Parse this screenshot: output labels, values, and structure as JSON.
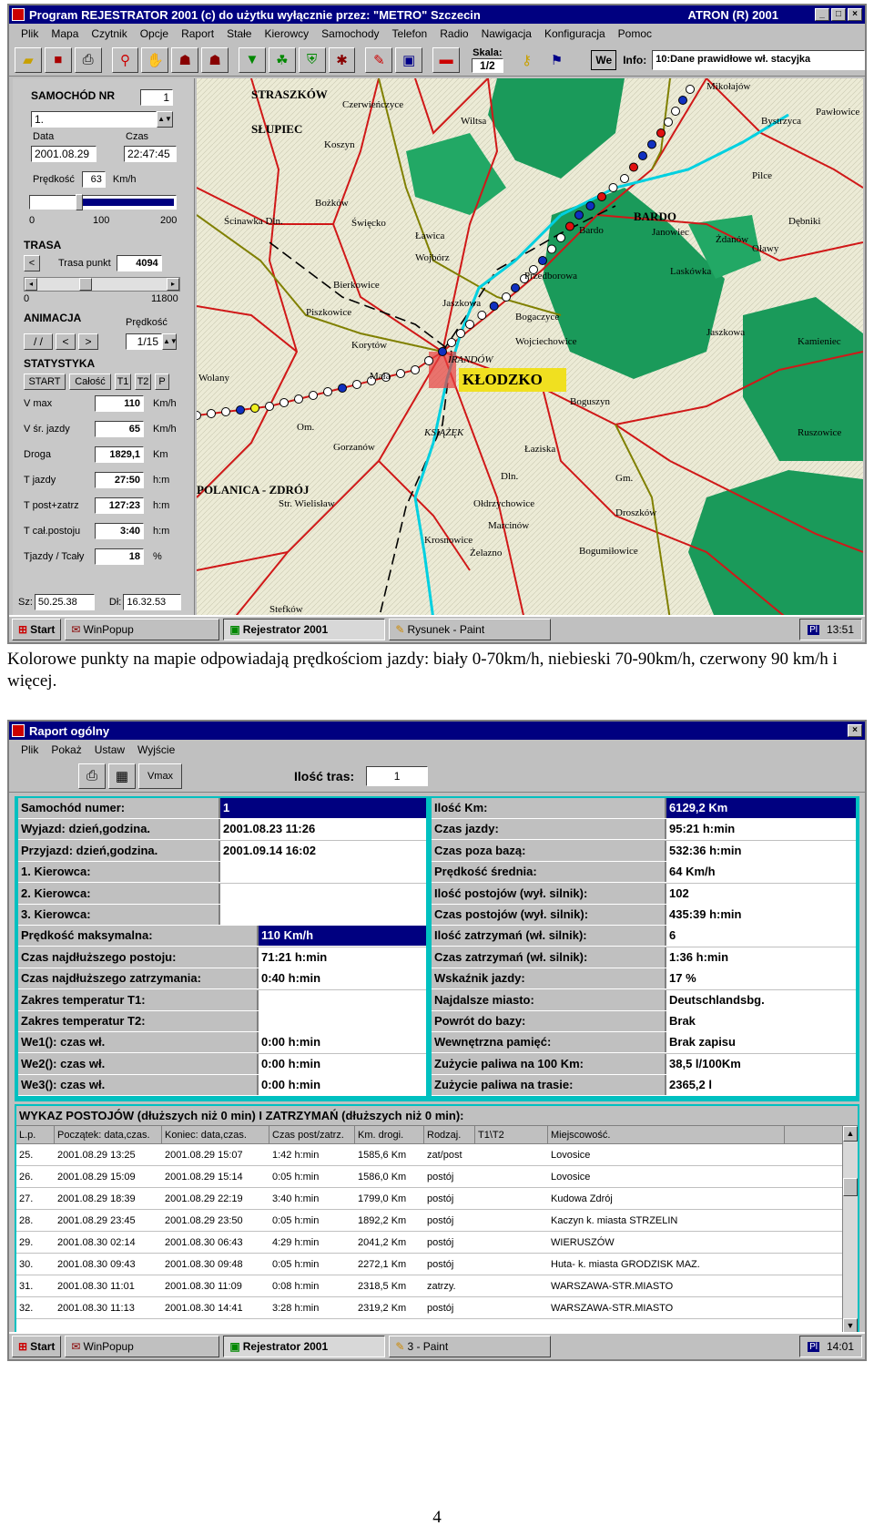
{
  "window1": {
    "title": "Program REJESTRATOR 2001 (c) do użytku wyłącznie przez: \"METRO\" Szczecin",
    "title_right": "ATRON (R) 2001",
    "title_buttons": [
      "_",
      "□",
      "×"
    ],
    "menu": [
      "Plik",
      "Mapa",
      "Czytnik",
      "Opcje",
      "Raport",
      "Stałe",
      "Kierowcy",
      "Samochody",
      "Telefon",
      "Radio",
      "Nawigacja",
      "Konfiguracja",
      "Pomoc"
    ],
    "toolbar": {
      "skala_label": "Skala:",
      "skala_value": "1/2",
      "we_label": "We",
      "info_label": "Info:",
      "info_value": "10:Dane prawidłowe wł. stacyjka"
    },
    "side": {
      "samochod_label": "SAMOCHÓD NR",
      "samochod_nr": "1",
      "samochod_name": "1.",
      "data_label": "Data",
      "czas_label": "Czas",
      "data_value": "2001.08.29",
      "czas_value": "22:47:45",
      "predkosc_label": "Prędkość",
      "predkosc_value": "63",
      "predkosc_unit": "Km/h",
      "speed_level": 0.32,
      "scale_0": "0",
      "scale_100": "100",
      "scale_200": "200",
      "trasa_label": "TRASA",
      "trasa_punkt_label": "Trasa punkt",
      "trasa_punkt_value": "4094",
      "trasa_min": "0",
      "trasa_max": "11800",
      "trasa_level": 0.35,
      "animacja_label": "ANIMACJA",
      "anim_predkosc_label": "Prędkość",
      "anim_predkosc_value": "1/15",
      "anim_buttons": [
        "/ /",
        "<",
        ">"
      ],
      "statystyka_label": "STATYSTYKA",
      "stat_buttons": [
        "START",
        "Całość",
        "T1",
        "T2",
        "P"
      ],
      "stats": [
        {
          "k": "V max",
          "v": "110",
          "u": "Km/h"
        },
        {
          "k": "V śr. jazdy",
          "v": "65",
          "u": "Km/h"
        },
        {
          "k": "Droga",
          "v": "1829,1",
          "u": "Km"
        },
        {
          "k": "T jazdy",
          "v": "27:50",
          "u": "h:m"
        },
        {
          "k": "T post+zatrz",
          "v": "127:23",
          "u": "h:m"
        },
        {
          "k": "T cał.postoju",
          "v": "3:40",
          "u": "h:m"
        },
        {
          "k": "Tjazdy / Tcały",
          "v": "18",
          "u": "%"
        }
      ],
      "sz_label": "Sz:",
      "sz_value": "50.25.38",
      "dl_label": "Dł:",
      "dl_value": "16.32.53"
    },
    "map_labels": [
      "STRASZKÓW",
      "Czerwieńczyce",
      "SŁUPIEC",
      "Koszyn",
      "Wiltsa",
      "Mikołajów",
      "Bystrzyca",
      "Pawłowice",
      "Ścinawka Dln.",
      "Bożków",
      "Święcko",
      "Ławica",
      "Bardo",
      "BARDO",
      "Janowiec",
      "Pilce",
      "Dębniki",
      "Żdanów",
      "Oławy",
      "Przedborowa",
      "Piszkowice",
      "Wojbórz",
      "Laskówka",
      "Bierkowice",
      "Korytów",
      "Jaszkowa",
      "Bogaczyce",
      "Wojciechowice",
      "IRANDÓW",
      "KŁODZKO",
      "Boguszyn",
      "KSIĄŻĘK",
      "Jaszkowa",
      "Łaziska",
      "Mała",
      "POLANICA - ZDRÓJ",
      "Str. Wielisław",
      "Gorzanów",
      "Dln.",
      "Ołdrzychowice",
      "Marcinów",
      "Droszków",
      "Krosnowice",
      "Żelazno",
      "Bogumiłowice",
      "Kamieniec",
      "Ruszowice",
      "Wolany",
      "Om.",
      "Gm.",
      "Stefków"
    ],
    "taskbar": {
      "start": "Start",
      "tasks": [
        "WinPopup",
        "Rejestrator 2001",
        "Rysunek - Paint"
      ],
      "active_index": 1,
      "tray_kb": "Pl",
      "clock": "13:51"
    }
  },
  "caption": "Kolorowe punkty na mapie odpowiadają prędkościom jazdy: biały 0-70km/h, niebieski 70-90km/h, czerwony 90 km/h i więcej.",
  "window2": {
    "title": "Raport ogólny",
    "menu": [
      "Plik",
      "Pokaż",
      "Ustaw",
      "Wyjście"
    ],
    "toolbar": {
      "vmax_btn": "Vmax",
      "ilosc_tras_label": "Ilość tras:",
      "ilosc_tras_value": "1"
    },
    "left_stats": [
      {
        "k": "Samochód numer:",
        "v": "1"
      },
      {
        "k": "Wyjazd: dzień,godzina.",
        "v": "2001.08.23  11:26"
      },
      {
        "k": "Przyjazd: dzień,godzina.",
        "v": "2001.09.14  16:02"
      },
      {
        "k": "1. Kierowca:",
        "v": ""
      },
      {
        "k": "2. Kierowca:",
        "v": ""
      },
      {
        "k": "3. Kierowca:",
        "v": ""
      },
      {
        "k": "Prędkość maksymalna:",
        "v": "110 Km/h"
      },
      {
        "k": "Czas najdłuższego postoju:",
        "v": "71:21 h:min"
      },
      {
        "k": "Czas najdłuższego zatrzymania:",
        "v": "0:40 h:min"
      },
      {
        "k": "Zakres temperatur T1:",
        "v": ""
      },
      {
        "k": "Zakres temperatur T2:",
        "v": ""
      },
      {
        "k": "We1(): czas wł.",
        "v": "0:00 h:min"
      },
      {
        "k": "We2(): czas wł.",
        "v": "0:00 h:min"
      },
      {
        "k": "We3(): czas wł.",
        "v": "0:00 h:min"
      }
    ],
    "right_stats": [
      {
        "k": "Ilość Km:",
        "v": "6129,2 Km"
      },
      {
        "k": "Czas jazdy:",
        "v": "95:21 h:min"
      },
      {
        "k": "Czas poza bazą:",
        "v": "532:36 h:min"
      },
      {
        "k": "Prędkość średnia:",
        "v": "64 Km/h"
      },
      {
        "k": "Ilość postojów (wył. silnik):",
        "v": "102"
      },
      {
        "k": "Czas postojów (wył. silnik):",
        "v": "435:39 h:min"
      },
      {
        "k": "Ilość zatrzymań (wł. silnik):",
        "v": "6"
      },
      {
        "k": "Czas zatrzymań (wł. silnik):",
        "v": "1:36 h:min"
      },
      {
        "k": "Wskaźnik jazdy:",
        "v": "17 %"
      },
      {
        "k": "Najdalsze miasto:",
        "v": "Deutschlandsbg."
      },
      {
        "k": "Powrót do bazy:",
        "v": "Brak"
      },
      {
        "k": "Wewnętrzna pamięć:",
        "v": "Brak zapisu"
      },
      {
        "k": "Zużycie paliwa na 100 Km:",
        "v": "38,5 l/100Km"
      },
      {
        "k": "Zużycie paliwa na trasie:",
        "v": "2365,2 l"
      }
    ],
    "list_title": "WYKAZ POSTOJÓW (dłuższych niż 0 min) I ZATRZYMAŃ (dłuższych niż 0 min):",
    "columns": [
      "L.p.",
      "Początek: data,czas.",
      "Koniec: data,czas.",
      "Czas post/zatrz.",
      "Km. drogi.",
      "Rodzaj.",
      "T1\\T2",
      "Miejscowość."
    ],
    "rows": [
      [
        "25.",
        "2001.08.29  13:25",
        "2001.08.29  15:07",
        "1:42 h:min",
        "1585,6 Km",
        "zat/post",
        "",
        "Lovosice"
      ],
      [
        "26.",
        "2001.08.29  15:09",
        "2001.08.29  15:14",
        "0:05 h:min",
        "1586,0 Km",
        "postój",
        "",
        "Lovosice"
      ],
      [
        "27.",
        "2001.08.29  18:39",
        "2001.08.29  22:19",
        "3:40 h:min",
        "1799,0 Km",
        "postój",
        "",
        "Kudowa Zdrój"
      ],
      [
        "28.",
        "2001.08.29  23:45",
        "2001.08.29  23:50",
        "0:05 h:min",
        "1892,2 Km",
        "postój",
        "",
        "Kaczyn  k. miasta STRZELIN"
      ],
      [
        "29.",
        "2001.08.30  02:14",
        "2001.08.30  06:43",
        "4:29 h:min",
        "2041,2 Km",
        "postój",
        "",
        "WIERUSZÓW"
      ],
      [
        "30.",
        "2001.08.30  09:43",
        "2001.08.30  09:48",
        "0:05 h:min",
        "2272,1 Km",
        "postój",
        "",
        "Huta-  k. miasta GRODZISK MAZ."
      ],
      [
        "31.",
        "2001.08.30  11:01",
        "2001.08.30  11:09",
        "0:08 h:min",
        "2318,5 Km",
        "zatrzy.",
        "",
        "WARSZAWA-STR.MIASTO"
      ],
      [
        "32.",
        "2001.08.30  11:13",
        "2001.08.30  14:41",
        "3:28 h:min",
        "2319,2 Km",
        "postój",
        "",
        "WARSZAWA-STR.MIASTO"
      ]
    ],
    "taskbar": {
      "start": "Start",
      "tasks": [
        "WinPopup",
        "Rejestrator 2001",
        "3 - Paint"
      ],
      "active_index": 1,
      "tray_kb": "Pl",
      "clock": "14:01"
    }
  },
  "page_number": "4"
}
